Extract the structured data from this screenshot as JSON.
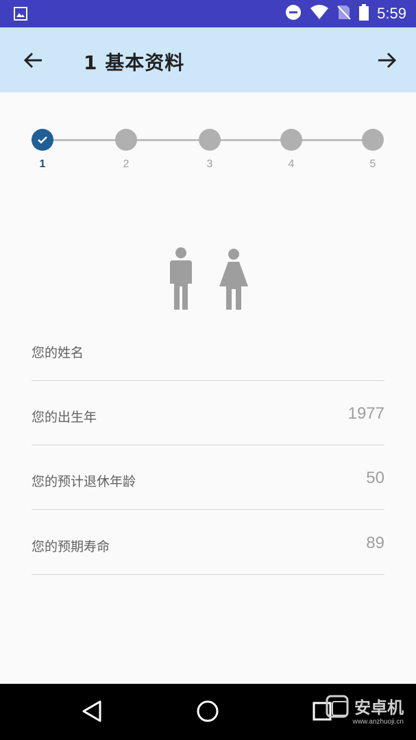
{
  "status_bar": {
    "time": "5:59",
    "icons": [
      "image-icon",
      "dnd-icon",
      "wifi-icon",
      "no-sim-icon",
      "battery-icon"
    ]
  },
  "app_bar": {
    "title": "1 基本资料",
    "back_icon": "arrow-left-icon",
    "forward_icon": "arrow-right-icon",
    "background": "#cde7f8"
  },
  "stepper": {
    "steps": [
      "1",
      "2",
      "3",
      "4",
      "5"
    ],
    "current": 1,
    "active_color": "#1f5f95",
    "inactive_color": "#b0b0b0"
  },
  "gender": {
    "options": [
      "male-icon",
      "female-icon"
    ]
  },
  "form": {
    "name_label": "您的姓名",
    "name_value": "",
    "birth_label": "您的出生年",
    "birth_value": "1977",
    "retire_label": "您的预计退休年龄",
    "retire_value": "50",
    "life_label": "您的预期寿命",
    "life_value": "89"
  },
  "nav_bar": {
    "watermark_text": "安卓机",
    "watermark_url": "www.anzhuoji.cn"
  }
}
